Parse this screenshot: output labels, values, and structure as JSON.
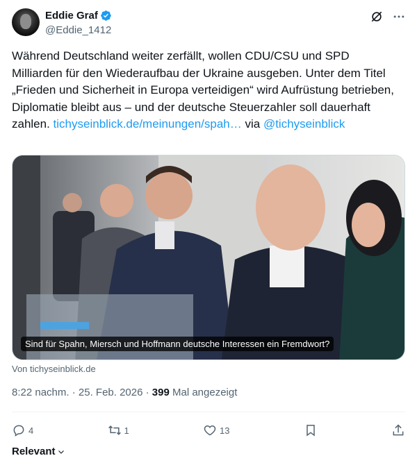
{
  "author": {
    "name": "Eddie Graf",
    "handle": "@Eddie_1412"
  },
  "tweet": {
    "text": "Während Deutschland weiter zerfällt, wollen CDU/CSU und SPD Milliarden für den Wiederaufbau der Ukraine ausgeben. Unter dem Titel „Frieden und Sicherheit in Europa verteidigen“ wird Aufrüstung betrieben, Diplomatie bleibt aus – und der deutsche Steuerzahler soll dauerhaft zahlen. ",
    "link": "tichyseinblick.de/meinungen/spah…",
    "via": " via ",
    "mention": "@tichyseinblick"
  },
  "card": {
    "caption": "Sind für Spahn, Miersch und Hoffmann deutsche Interessen ein Fremdwort?",
    "source": "Von tichyseinblick.de"
  },
  "meta": {
    "time_date": "8:22 nachm. · 25. Feb. 2026 · ",
    "views": "399",
    "views_label": " Mal angezeigt"
  },
  "actions": {
    "replies": "4",
    "reposts": "1",
    "likes": "13"
  },
  "sort": {
    "label": "Relevant"
  },
  "colors": {
    "accent": "#1d9bf0",
    "secondary_text": "#536471"
  }
}
